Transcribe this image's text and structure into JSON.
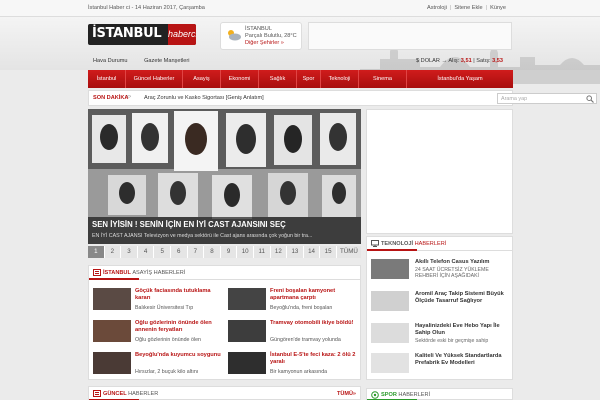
{
  "topbar": {
    "date": "İstanbul Haber ci - 14 Haziran 2017, Çarşamba",
    "links": [
      "Astroloji",
      "Sitene Ekle",
      "Künye"
    ]
  },
  "logo": {
    "main": "İSTANBUL",
    "sub": "haberci"
  },
  "weather": {
    "city": "İSTANBUL",
    "forecast": "Parçalı Bulutlu, 28°C",
    "link": "Diğer Şehirler »"
  },
  "subnav": [
    "Hava Durumu",
    "Gazete Manşetleri"
  ],
  "currency": {
    "label": "$ DOLAR",
    "buy_label": "Alış:",
    "buy": "3,51",
    "sell_label": "Satış:",
    "sell": "3,53"
  },
  "mainnav": [
    "İstanbul",
    "Güncel Haberler",
    "Asayiş",
    "Ekonomi",
    "Sağlık",
    "Spor",
    "Teknoloji",
    "Sinema",
    "İstanbul'da Yaşam"
  ],
  "breaking": {
    "label": "SON DAKİKA",
    "text": "Araç Zorunlu ve Kasko Sigortası [Geniş Anlatım]",
    "search_placeholder": "Arama yap"
  },
  "slider": {
    "title": "SEN İYİSİN ! SENİN İÇİN EN İYİ CAST AJANSINI SEÇ",
    "desc": "EN İYİ CAST AJANSI Televizyon ve medya sektörü ile Cast ajans arasında çok yoğun bir tra...",
    "pages": [
      "1",
      "2",
      "3",
      "4",
      "5",
      "6",
      "7",
      "8",
      "9",
      "10",
      "11",
      "12",
      "13",
      "14",
      "15"
    ],
    "all_label": "TÜMÜ",
    "active_page": 1
  },
  "asayis": {
    "title_prefix": "İSTANBUL",
    "title_rest": "ASAYİŞ HABERLERİ",
    "items": [
      {
        "h": "Göçük faciasında tutuklama kararı",
        "s": "Balıkesir Üniversitesi Tıp"
      },
      {
        "h": "Freni boşalan kamyonet apartmana çarptı",
        "s": "Beyoğlu'nda, freni boşalan"
      },
      {
        "h": "Oğlu gözlerinin önünde ölen annenin feryatları",
        "s": "Oğlu gözlerinin önünde ölen"
      },
      {
        "h": "Tramvay otomobili ikiye böldü!",
        "s": "Güngören'de tramvay yolunda"
      },
      {
        "h": "Beyoğlu'nda kuyumcu soygunu",
        "s": "Hırsızlar, 2 buçuk kilo altını"
      },
      {
        "h": "İstanbul E-5'te feci kaza: 2 ölü 2 yaralı",
        "s": "Bir kamyonun arkasında"
      }
    ]
  },
  "guncel": {
    "prefix": "GÜNCEL",
    "rest": "HABERLER",
    "more": "TÜMÜ»"
  },
  "teknoloji": {
    "prefix": "TEKNOLOJİ",
    "rest": "HABERLERİ",
    "items": [
      {
        "h": "Akıllı Telefon Casus Yazılım",
        "s": "24 SAAT ÜCRETSİZ YÜKLEME REHBERİ İÇİN AŞAĞIDAKİ"
      },
      {
        "h": "Aromil Araç Takip Sistemi Büyük Ölçüde Tasarruf Sağlıyor",
        "s": ""
      },
      {
        "h": "Hayalinizdeki Eve Hebo Yapı İle Sahip Olun",
        "s": "Sektörde eski bir geçmişe sahip"
      },
      {
        "h": "Kaliteli Ve Yüksek Standartlarda Prefabrik Ev Modelleri",
        "s": ""
      }
    ]
  },
  "spor": {
    "prefix": "SPOR",
    "rest": "HABERLERİ"
  }
}
